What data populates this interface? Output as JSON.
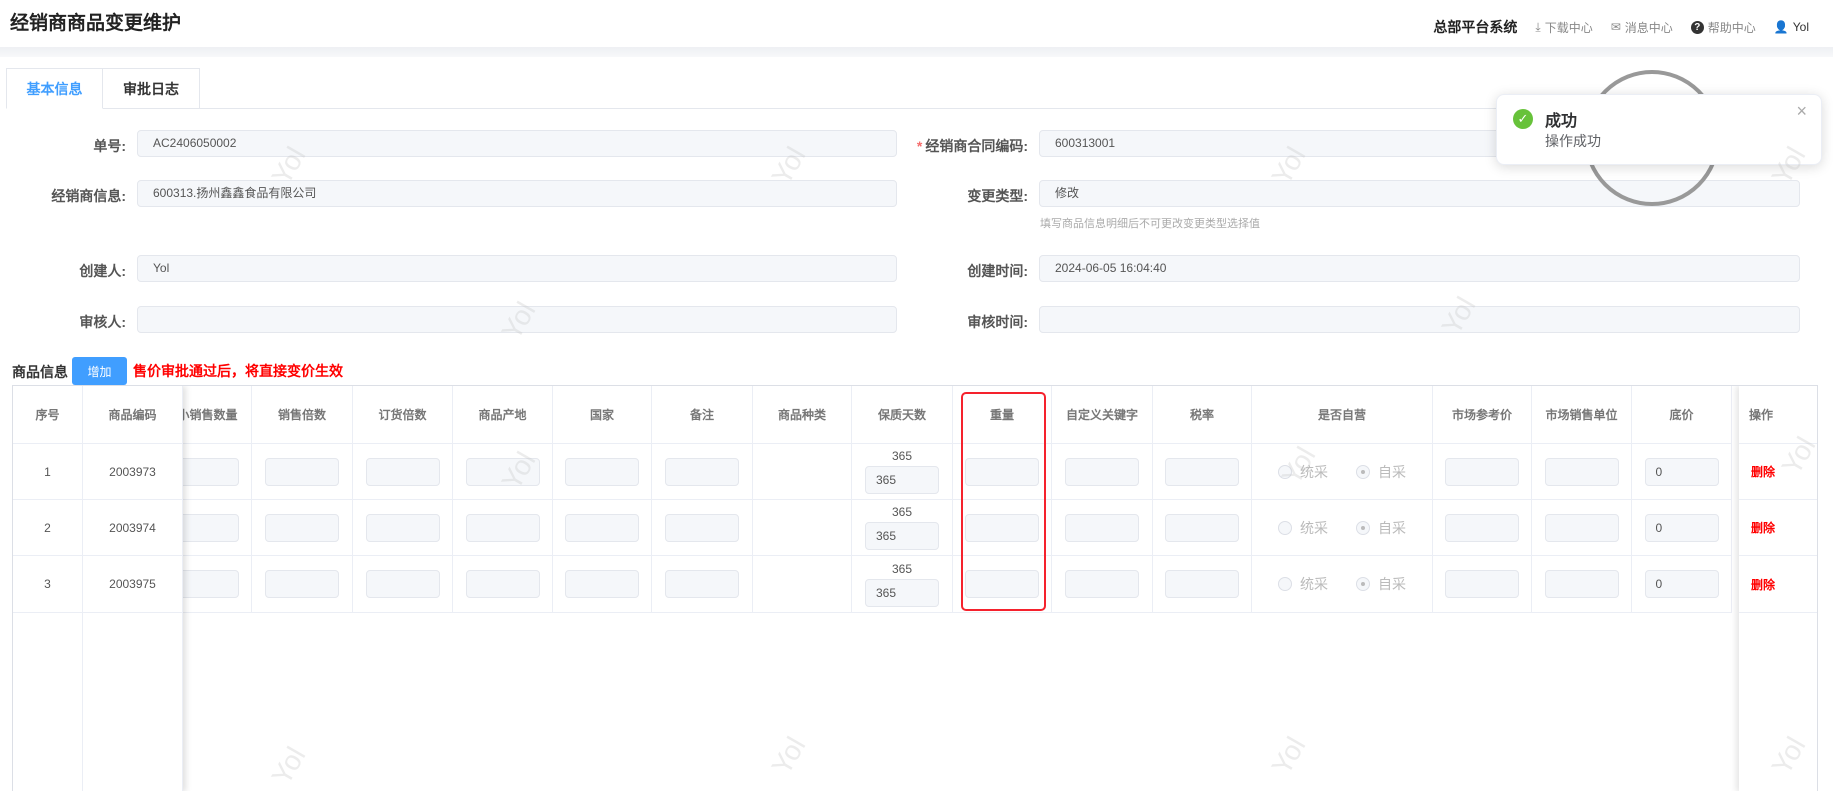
{
  "header": {
    "title": "经销商商品变更维护",
    "system": "总部平台系统",
    "download": "下载中心",
    "messages": "消息中心",
    "help": "帮助中心",
    "user": "Yol"
  },
  "tabs": [
    {
      "label": "基本信息",
      "active": true
    },
    {
      "label": "审批日志",
      "active": false
    }
  ],
  "form": {
    "order_no": {
      "label": "单号:",
      "value": "AC2406050002"
    },
    "contract_code": {
      "label": "经销商合同编码:",
      "value": "600313001",
      "required_mark": "*"
    },
    "dealer_info": {
      "label": "经销商信息:",
      "value": "600313.扬州鑫鑫食品有限公司"
    },
    "change_type": {
      "label": "变更类型:",
      "value": "修改",
      "hint": "填写商品信息明细后不可更改变更类型选择值"
    },
    "creator": {
      "label": "创建人:",
      "value": "Yol"
    },
    "create_time": {
      "label": "创建时间:",
      "value": "2024-06-05 16:04:40"
    },
    "reviewer": {
      "label": "审核人:",
      "value": ""
    },
    "review_time": {
      "label": "审核时间:",
      "value": ""
    }
  },
  "goods": {
    "section_title": "商品信息",
    "add_button": "增加",
    "warning": "售价审批通过后，将直接变价生效"
  },
  "table": {
    "fixed_left_headers": [
      "序号",
      "商品编码"
    ],
    "headers": [
      "最小销售数量",
      "销售倍数",
      "订货倍数",
      "商品产地",
      "国家",
      "备注",
      "商品种类",
      "保质天数",
      "重量",
      "自定义关键字",
      "税率",
      "是否自营",
      "市场参考价",
      "市场销售单位",
      "底价"
    ],
    "action_header": "操作",
    "radio_options": [
      "统采",
      "自采"
    ],
    "rows": [
      {
        "index": "1",
        "code": "2003973",
        "shelf_days_text": "365",
        "shelf_days_input": "365",
        "base_price": "0",
        "selected": "自采",
        "action": "删除"
      },
      {
        "index": "2",
        "code": "2003974",
        "shelf_days_text": "365",
        "shelf_days_input": "365",
        "base_price": "0",
        "selected": "自采",
        "action": "删除"
      },
      {
        "index": "3",
        "code": "2003975",
        "shelf_days_text": "365",
        "shelf_days_input": "365",
        "base_price": "0",
        "selected": "自采",
        "action": "删除"
      }
    ]
  },
  "toast": {
    "title": "成功",
    "message": "操作成功",
    "close": "×"
  },
  "watermark": "Yol",
  "colors": {
    "primary": "#409eff",
    "danger": "#f00",
    "success": "#67c23a"
  }
}
